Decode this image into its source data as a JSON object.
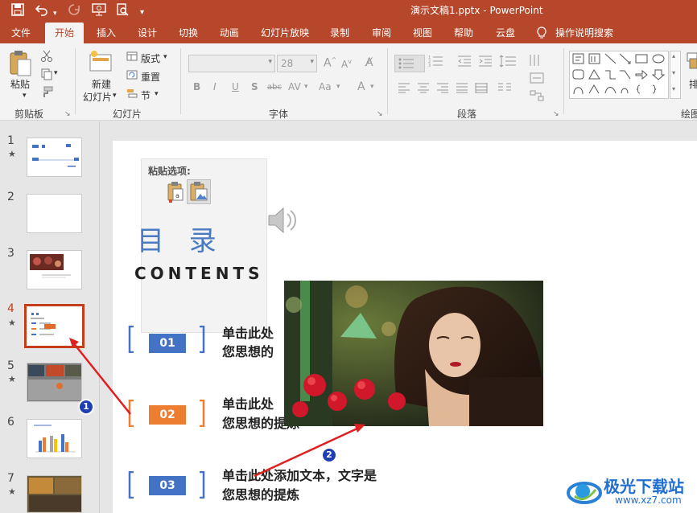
{
  "titlebar": {
    "doc_title": "演示文稿1.pptx  -  PowerPoint",
    "quick_access": [
      "save-icon",
      "undo-icon",
      "redo-icon",
      "present-from-start-icon",
      "print-preview-icon",
      "customize-icon"
    ]
  },
  "tabs": [
    {
      "label": "文件"
    },
    {
      "label": "开始",
      "active": true
    },
    {
      "label": "插入"
    },
    {
      "label": "设计"
    },
    {
      "label": "切换"
    },
    {
      "label": "动画"
    },
    {
      "label": "幻灯片放映"
    },
    {
      "label": "录制"
    },
    {
      "label": "审阅"
    },
    {
      "label": "视图"
    },
    {
      "label": "帮助"
    },
    {
      "label": "云盘"
    },
    {
      "label": "操作说明搜索"
    }
  ],
  "ribbon": {
    "clipboard": {
      "label": "剪贴板",
      "paste": "粘贴"
    },
    "slides": {
      "label": "幻灯片",
      "new_slide_line1": "新建",
      "new_slide_line2": "幻灯片",
      "layout": "版式",
      "reset": "重置",
      "section": "节"
    },
    "font": {
      "label": "字体",
      "font_size": "28"
    },
    "paragraph": {
      "label": "段落"
    },
    "drawing": {
      "label": "绘图",
      "arrange": "排"
    }
  },
  "thumbnails": [
    {
      "num": "1",
      "star": "★"
    },
    {
      "num": "2",
      "star": ""
    },
    {
      "num": "3",
      "star": ""
    },
    {
      "num": "4",
      "star": "★",
      "selected": true
    },
    {
      "num": "5",
      "star": "★"
    },
    {
      "num": "6",
      "star": ""
    },
    {
      "num": "7",
      "star": "★"
    }
  ],
  "slide": {
    "paste_options_title": "粘贴选项:",
    "heading": "目 录",
    "subheading": "CONTENTS",
    "items": [
      {
        "num": "01",
        "text_line1": "单击此处",
        "text_line2": "您思想的",
        "color": "#4472c4"
      },
      {
        "num": "02",
        "text_line1": "单击此处",
        "text_line2": "您思想的提炼",
        "color": "#ed7d31"
      },
      {
        "num": "03",
        "text_line1": "单击此处添加文本，文字是",
        "text_line2": "您思想的提炼",
        "color": "#4472c4"
      }
    ]
  },
  "annotations": {
    "badge1": "1",
    "badge2": "2",
    "arrow_color": "#e02020"
  },
  "watermark": {
    "name": "极光下载站",
    "url": "www.xz7.com"
  }
}
